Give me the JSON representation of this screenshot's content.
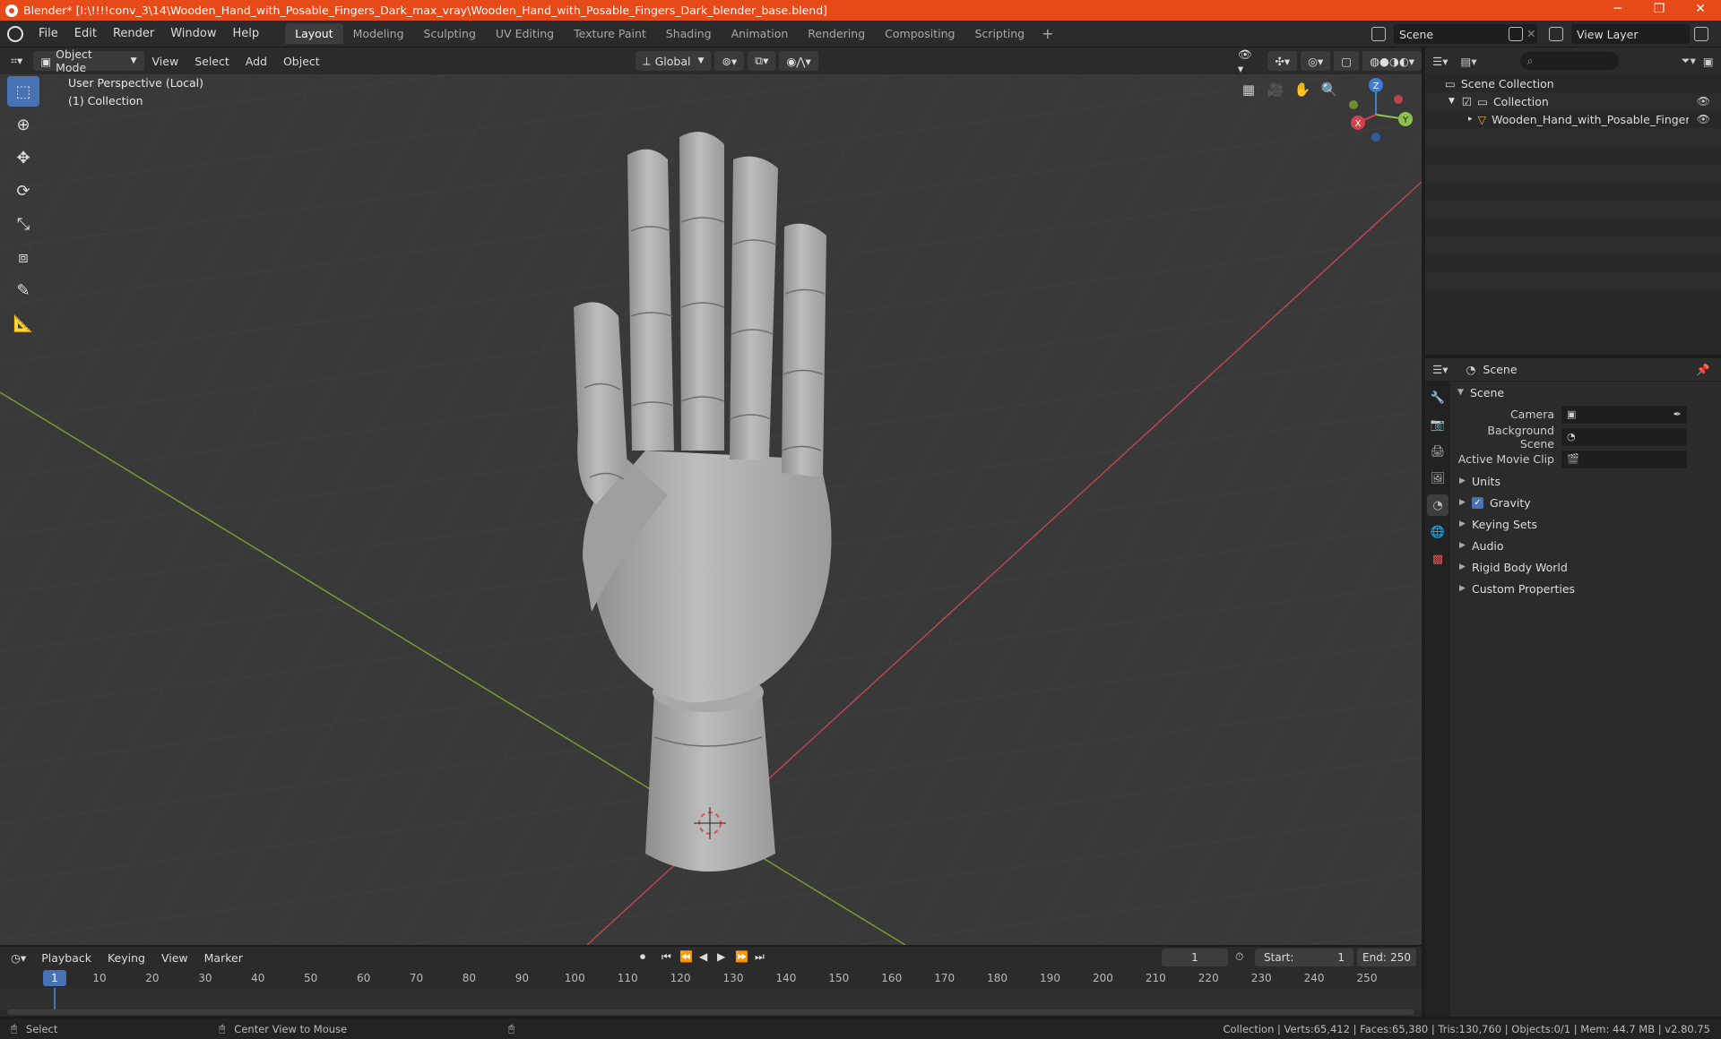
{
  "window": {
    "title": "Blender* [I:\\!!!!conv_3\\14\\Wooden_Hand_with_Posable_Fingers_Dark_max_vray\\Wooden_Hand_with_Posable_Fingers_Dark_blender_base.blend]",
    "minimize": "─",
    "restore": "❐",
    "close": "✕"
  },
  "menu": [
    "File",
    "Edit",
    "Render",
    "Window",
    "Help"
  ],
  "workspaces": [
    "Layout",
    "Modeling",
    "Sculpting",
    "UV Editing",
    "Texture Paint",
    "Shading",
    "Animation",
    "Rendering",
    "Compositing",
    "Scripting"
  ],
  "workspace_add": "+",
  "scene_name": "Scene",
  "view_layer": "View Layer",
  "viewport_header": {
    "mode": "Object Mode",
    "menus": [
      "View",
      "Select",
      "Add",
      "Object"
    ],
    "orientation": "Global"
  },
  "viewport": {
    "perspective": "User Perspective (Local)",
    "collection": "(1) Collection",
    "gizmo": {
      "x": "X",
      "y": "Y",
      "z": "Z"
    }
  },
  "outliner": {
    "rows": [
      {
        "label": "Scene Collection"
      },
      {
        "label": "Collection"
      },
      {
        "label": "Wooden_Hand_with_Posable_Fingers_Dark_t"
      }
    ]
  },
  "properties": {
    "header_title": "Scene",
    "panel_title": "Scene",
    "fields": [
      {
        "label": "Camera"
      },
      {
        "label": "Background Scene"
      },
      {
        "label": "Active Movie Clip"
      }
    ],
    "subpanels": [
      "Units",
      "Gravity",
      "Keying Sets",
      "Audio",
      "Rigid Body World",
      "Custom Properties"
    ]
  },
  "timeline": {
    "menus": [
      "Playback",
      "Keying",
      "View",
      "Marker"
    ],
    "current_frame": "1",
    "start_label": "Start:",
    "start": "1",
    "end_label": "End:",
    "end": "250",
    "ticks": [
      "1",
      "10",
      "20",
      "30",
      "40",
      "50",
      "60",
      "70",
      "80",
      "90",
      "100",
      "110",
      "120",
      "130",
      "140",
      "150",
      "160",
      "170",
      "180",
      "190",
      "200",
      "210",
      "220",
      "230",
      "240",
      "250"
    ]
  },
  "status": {
    "left": "Select",
    "middle": "Center View to Mouse",
    "right": "Collection | Verts:65,412 | Faces:65,380 | Tris:130,760 | Objects:0/1 | Mem: 44.7 MB | v2.80.75"
  },
  "colors": {
    "accent": "#4772b3",
    "titlebar": "#e64a19",
    "x_axis": "#d3414b",
    "y_axis": "#8bc34a",
    "z_axis": "#3b7ddd"
  }
}
